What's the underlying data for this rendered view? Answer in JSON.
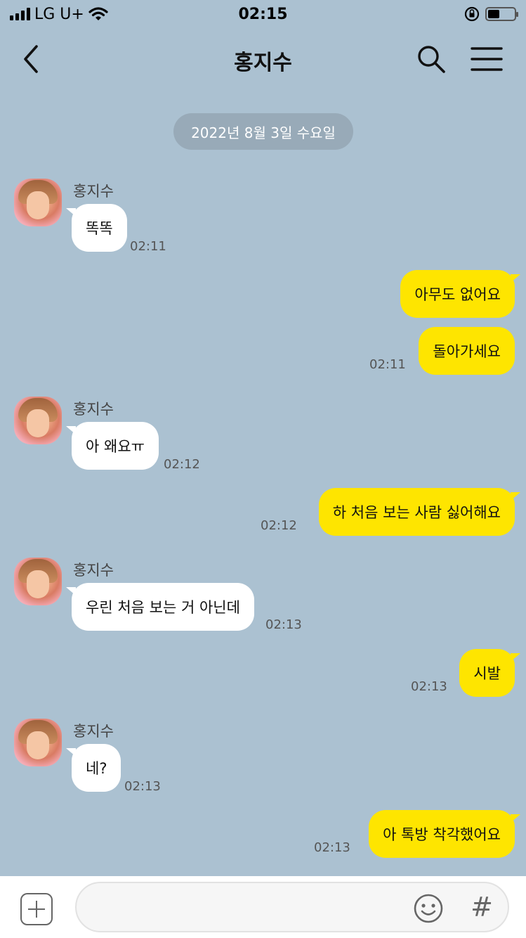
{
  "status_bar": {
    "carrier": "LG U+",
    "time": "02:15",
    "battery_level": 0.45
  },
  "header": {
    "title": "홍지수"
  },
  "date_divider": "2022년 8월 3일 수요일",
  "colors": {
    "background": "#abc1d1",
    "incoming_bubble": "#ffffff",
    "outgoing_bubble": "#fee500"
  },
  "messages": [
    {
      "id": "m1",
      "direction": "in",
      "sender": "홍지수",
      "text": "똑똑",
      "time": "02:11"
    },
    {
      "id": "m2",
      "direction": "out",
      "text": "아무도 없어요",
      "time": ""
    },
    {
      "id": "m3",
      "direction": "out",
      "text": "돌아가세요",
      "time": "02:11"
    },
    {
      "id": "m4",
      "direction": "in",
      "sender": "홍지수",
      "text": "아 왜요ㅠ",
      "time": "02:12"
    },
    {
      "id": "m5",
      "direction": "out",
      "text": "하 처음 보는 사람 싫어해요",
      "time": "02:12"
    },
    {
      "id": "m6",
      "direction": "in",
      "sender": "홍지수",
      "text": "우린 처음 보는 거 아닌데",
      "time": "02:13"
    },
    {
      "id": "m7",
      "direction": "out",
      "text": "시발",
      "time": "02:13"
    },
    {
      "id": "m8",
      "direction": "in",
      "sender": "홍지수",
      "text": "네?",
      "time": "02:13"
    },
    {
      "id": "m9",
      "direction": "out",
      "text": "아 톡방 착각했어요",
      "time": "02:13"
    }
  ],
  "input_bar": {
    "placeholder": "",
    "value": "",
    "hash_label": "#"
  }
}
